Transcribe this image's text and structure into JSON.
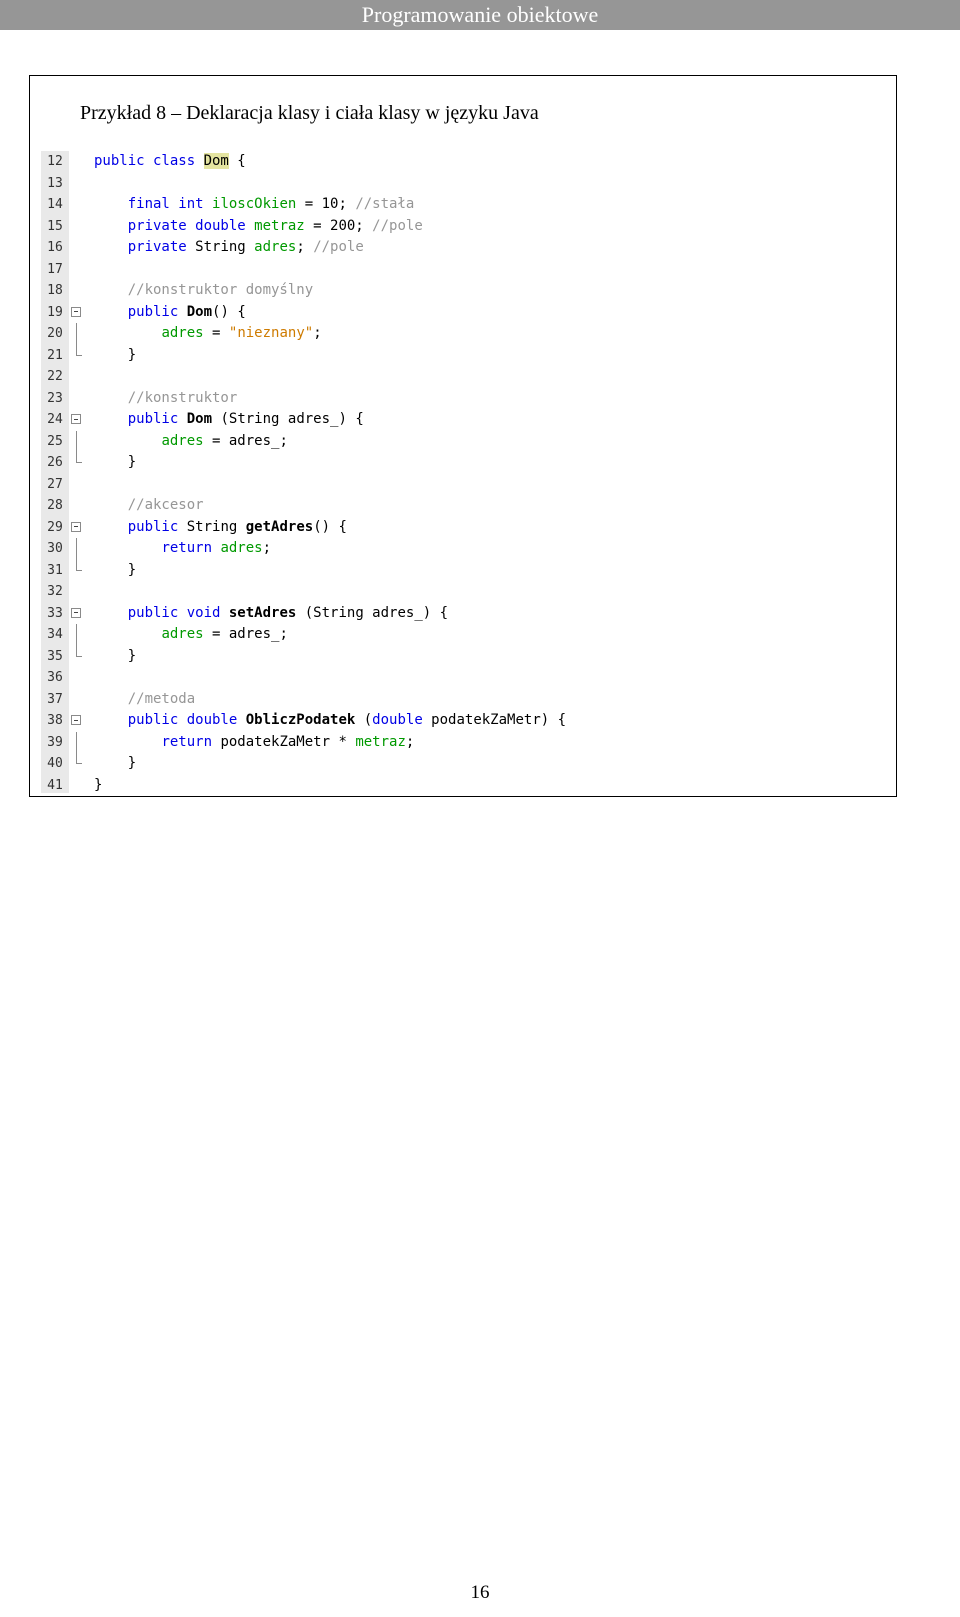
{
  "header": {
    "title": "Programowanie obiektowe"
  },
  "example": {
    "title": "Przykład 8 – Deklaracja klasy i ciała klasy w języku Java"
  },
  "code": {
    "line_numbers": [
      "12",
      "13",
      "14",
      "15",
      "16",
      "17",
      "18",
      "19",
      "20",
      "21",
      "22",
      "23",
      "24",
      "25",
      "26",
      "27",
      "28",
      "29",
      "30",
      "31",
      "32",
      "33",
      "34",
      "35",
      "36",
      "37",
      "38",
      "39",
      "40",
      "41"
    ],
    "lines": [
      {
        "indent": "",
        "tokens": [
          {
            "c": "kw",
            "t": "public class "
          },
          {
            "c": "hl",
            "t": "Dom"
          },
          {
            "c": "plain",
            "t": " {"
          }
        ]
      },
      {
        "indent": "",
        "tokens": []
      },
      {
        "indent": "    ",
        "tokens": [
          {
            "c": "kw",
            "t": "final int "
          },
          {
            "c": "fld",
            "t": "iloscOkien"
          },
          {
            "c": "plain",
            "t": " = 10; "
          },
          {
            "c": "cmt",
            "t": "//stała"
          }
        ]
      },
      {
        "indent": "    ",
        "tokens": [
          {
            "c": "kw",
            "t": "private double "
          },
          {
            "c": "fld",
            "t": "metraz"
          },
          {
            "c": "plain",
            "t": " = 200; "
          },
          {
            "c": "cmt",
            "t": "//pole"
          }
        ]
      },
      {
        "indent": "    ",
        "tokens": [
          {
            "c": "kw",
            "t": "private "
          },
          {
            "c": "plain",
            "t": "String "
          },
          {
            "c": "fld",
            "t": "adres"
          },
          {
            "c": "plain",
            "t": "; "
          },
          {
            "c": "cmt",
            "t": "//pole"
          }
        ]
      },
      {
        "indent": "",
        "tokens": []
      },
      {
        "indent": "    ",
        "tokens": [
          {
            "c": "cmt",
            "t": "//konstruktor domyślny"
          }
        ]
      },
      {
        "indent": "    ",
        "tokens": [
          {
            "c": "kw",
            "t": "public "
          },
          {
            "c": "bold",
            "t": "Dom"
          },
          {
            "c": "plain",
            "t": "() {"
          }
        ]
      },
      {
        "indent": "        ",
        "tokens": [
          {
            "c": "fld",
            "t": "adres"
          },
          {
            "c": "plain",
            "t": " = "
          },
          {
            "c": "str",
            "t": "\"nieznany\""
          },
          {
            "c": "plain",
            "t": ";"
          }
        ]
      },
      {
        "indent": "    ",
        "tokens": [
          {
            "c": "plain",
            "t": "}"
          }
        ]
      },
      {
        "indent": "",
        "tokens": []
      },
      {
        "indent": "    ",
        "tokens": [
          {
            "c": "cmt",
            "t": "//konstruktor"
          }
        ]
      },
      {
        "indent": "    ",
        "tokens": [
          {
            "c": "kw",
            "t": "public "
          },
          {
            "c": "bold",
            "t": "Dom"
          },
          {
            "c": "plain",
            "t": " (String adres_) {"
          }
        ]
      },
      {
        "indent": "        ",
        "tokens": [
          {
            "c": "fld",
            "t": "adres"
          },
          {
            "c": "plain",
            "t": " = adres_;"
          }
        ]
      },
      {
        "indent": "    ",
        "tokens": [
          {
            "c": "plain",
            "t": "}"
          }
        ]
      },
      {
        "indent": "",
        "tokens": []
      },
      {
        "indent": "    ",
        "tokens": [
          {
            "c": "cmt",
            "t": "//akcesor"
          }
        ]
      },
      {
        "indent": "    ",
        "tokens": [
          {
            "c": "kw",
            "t": "public "
          },
          {
            "c": "plain",
            "t": "String "
          },
          {
            "c": "bold",
            "t": "getAdres"
          },
          {
            "c": "plain",
            "t": "() {"
          }
        ]
      },
      {
        "indent": "        ",
        "tokens": [
          {
            "c": "kw",
            "t": "return "
          },
          {
            "c": "fld",
            "t": "adres"
          },
          {
            "c": "plain",
            "t": ";"
          }
        ]
      },
      {
        "indent": "    ",
        "tokens": [
          {
            "c": "plain",
            "t": "}"
          }
        ]
      },
      {
        "indent": "",
        "tokens": []
      },
      {
        "indent": "    ",
        "tokens": [
          {
            "c": "kw",
            "t": "public void "
          },
          {
            "c": "bold",
            "t": "setAdres"
          },
          {
            "c": "plain",
            "t": " (String adres_) {"
          }
        ]
      },
      {
        "indent": "        ",
        "tokens": [
          {
            "c": "fld",
            "t": "adres"
          },
          {
            "c": "plain",
            "t": " = adres_;"
          }
        ]
      },
      {
        "indent": "    ",
        "tokens": [
          {
            "c": "plain",
            "t": "}"
          }
        ]
      },
      {
        "indent": "",
        "tokens": []
      },
      {
        "indent": "    ",
        "tokens": [
          {
            "c": "cmt",
            "t": "//metoda"
          }
        ]
      },
      {
        "indent": "    ",
        "tokens": [
          {
            "c": "kw",
            "t": "public double "
          },
          {
            "c": "bold",
            "t": "ObliczPodatek"
          },
          {
            "c": "plain",
            "t": " ("
          },
          {
            "c": "kw",
            "t": "double"
          },
          {
            "c": "plain",
            "t": " podatekZaMetr) {"
          }
        ]
      },
      {
        "indent": "        ",
        "tokens": [
          {
            "c": "kw",
            "t": "return "
          },
          {
            "c": "plain",
            "t": "podatekZaMetr * "
          },
          {
            "c": "fld",
            "t": "metraz"
          },
          {
            "c": "plain",
            "t": ";"
          }
        ]
      },
      {
        "indent": "    ",
        "tokens": [
          {
            "c": "plain",
            "t": "}"
          }
        ]
      },
      {
        "indent": "",
        "tokens": [
          {
            "c": "plain",
            "t": "}"
          }
        ]
      }
    ],
    "fold_open": [
      7,
      12,
      17,
      21,
      26
    ],
    "fold_mid": [
      8,
      13,
      18,
      22,
      27
    ],
    "fold_end": [
      9,
      14,
      19,
      23,
      28
    ]
  },
  "footer": {
    "page_number": "16"
  },
  "colors": {
    "keyword": "#0000e6",
    "field": "#009900",
    "comment": "#969696",
    "string": "#ce7b00",
    "highlight": "#e4e4a0",
    "header_bar": "#969696"
  }
}
